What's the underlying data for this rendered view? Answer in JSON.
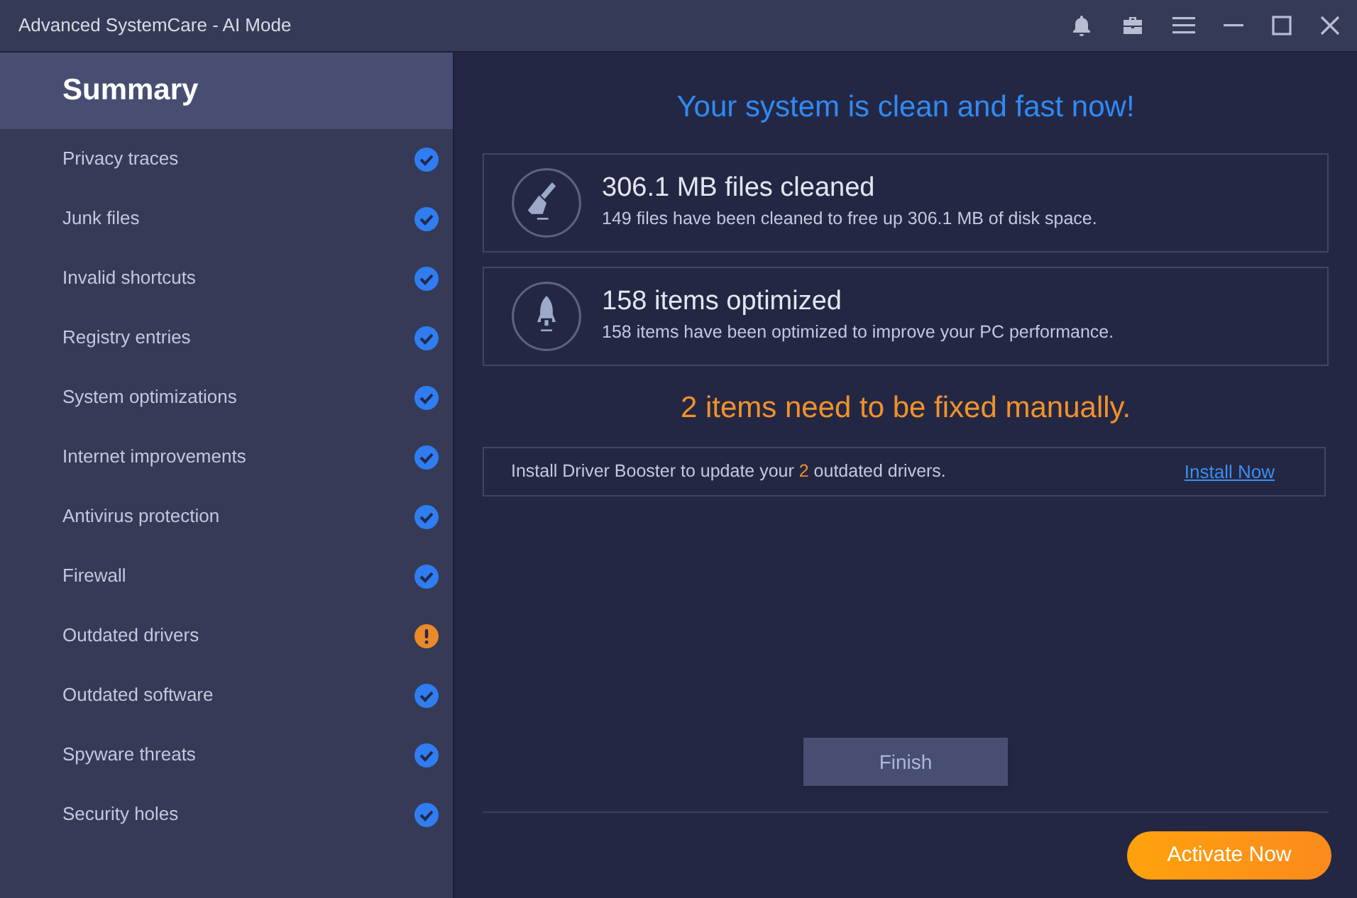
{
  "window": {
    "title": "Advanced SystemCare - AI Mode"
  },
  "sidebar": {
    "items": [
      {
        "label": "Summary",
        "selected": true,
        "kind": "header"
      },
      {
        "label": "Privacy traces",
        "selected": false,
        "kind": "ok"
      },
      {
        "label": "Junk files",
        "selected": false,
        "kind": "ok"
      },
      {
        "label": "Invalid shortcuts",
        "selected": false,
        "kind": "ok"
      },
      {
        "label": "Registry entries",
        "selected": false,
        "kind": "ok"
      },
      {
        "label": "System optimizations",
        "selected": false,
        "kind": "ok"
      },
      {
        "label": "Internet improvements",
        "selected": false,
        "kind": "ok"
      },
      {
        "label": "Antivirus protection",
        "selected": false,
        "kind": "ok"
      },
      {
        "label": "Firewall",
        "selected": false,
        "kind": "ok"
      },
      {
        "label": "Outdated drivers",
        "selected": false,
        "kind": "warning"
      },
      {
        "label": "Outdated software",
        "selected": false,
        "kind": "ok"
      },
      {
        "label": "Spyware threats",
        "selected": false,
        "kind": "ok"
      },
      {
        "label": "Security holes",
        "selected": false,
        "kind": "ok"
      }
    ]
  },
  "headline": "Your system is clean and fast now!",
  "results": [
    {
      "kind": "broom",
      "title": "306.1 MB files cleaned",
      "detail": "149 files have been cleaned to free up 306.1 MB of disk space."
    },
    {
      "kind": "rocket",
      "title": "158 items optimized",
      "detail": "158 items have been optimized to improve your PC performance."
    }
  ],
  "manual_notice": "2 items need to be fixed manually.",
  "driver_notice": {
    "parts": [
      "Install Driver Booster to update your ",
      "2",
      " outdated drivers."
    ],
    "link": "Install Now"
  },
  "finish_button": "Finish",
  "activate_button": "Activate Now"
}
